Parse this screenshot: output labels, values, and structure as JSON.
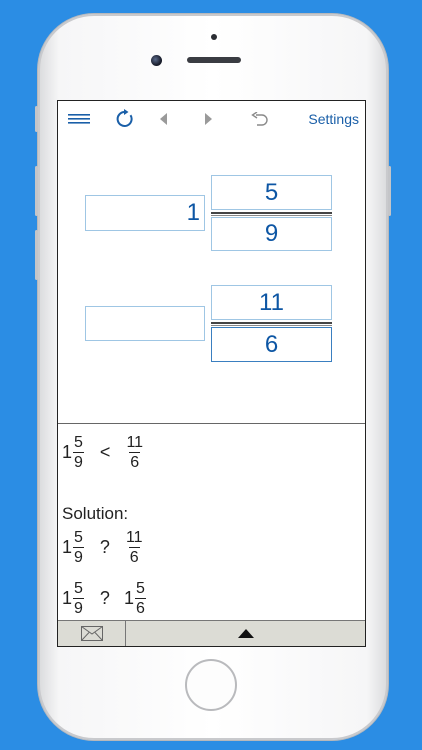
{
  "toolbar": {
    "settings_label": "Settings",
    "icons": [
      "menu-icon",
      "refresh-icon",
      "back-icon",
      "forward-icon",
      "undo-icon"
    ]
  },
  "inputs": {
    "first": {
      "whole": "1",
      "numerator": "5",
      "denominator": "9"
    },
    "second": {
      "whole": "",
      "numerator": "11",
      "denominator": "6"
    }
  },
  "result": {
    "lhs": {
      "whole": "1",
      "num": "5",
      "den": "9"
    },
    "op": "<",
    "rhs": {
      "whole": "",
      "num": "11",
      "den": "6"
    }
  },
  "solution": {
    "label": "Solution:",
    "steps": [
      {
        "lhs": {
          "whole": "1",
          "num": "5",
          "den": "9"
        },
        "op": "?",
        "rhs": {
          "whole": "",
          "num": "11",
          "den": "6"
        }
      },
      {
        "lhs": {
          "whole": "1",
          "num": "5",
          "den": "9"
        },
        "op": "?",
        "rhs": {
          "whole": "1",
          "num": "5",
          "den": "6"
        }
      }
    ]
  },
  "colors": {
    "background": "#2b8de4",
    "accent": "#1a5fa8",
    "field_border": "#9fc6e4"
  }
}
